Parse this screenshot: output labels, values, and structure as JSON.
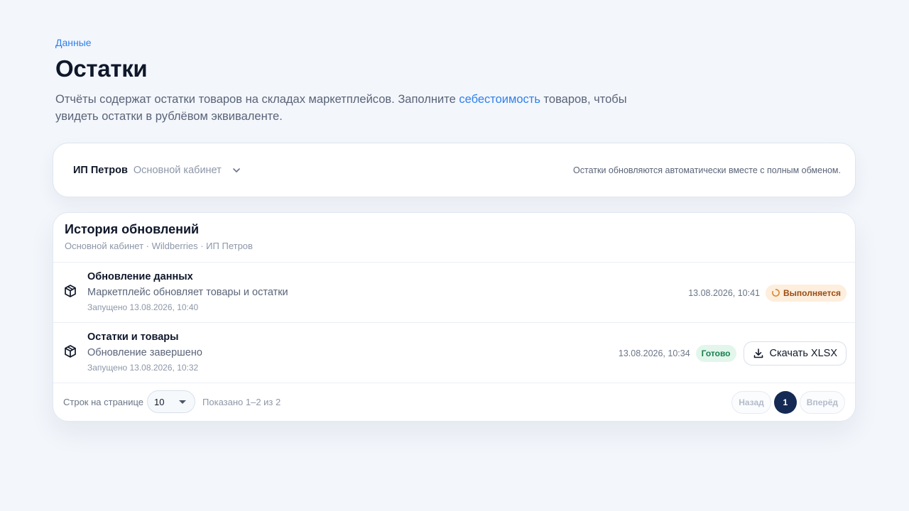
{
  "breadcrumb": "Данные",
  "page_title": "Остатки",
  "intro": {
    "before": "Отчёты содержат остатки товаров на складах маркетплейсов. Заполните ",
    "link": "себестоимость",
    "after": " товаров, чтобы увидеть остатки в рублёвом эквиваленте."
  },
  "account": {
    "name": "ИП Петров",
    "cabinet": "Основной кабинет",
    "note": "Остатки обновляются автоматически вместе с полным обменом."
  },
  "history": {
    "title": "История обновлений",
    "subtitle": "Основной кабинет · Wildberries · ИП Петров",
    "rows": [
      {
        "title": "Обновление данных",
        "desc": "Маркетплейс обновляет товары и остатки",
        "started": "Запущено 13.08.2026, 10:40",
        "time": "13.08.2026, 10:41",
        "status": "Выполняется"
      },
      {
        "title": "Остатки и товары",
        "desc": "Обновление завершено",
        "started": "Запущено 13.08.2026, 10:32",
        "time": "13.08.2026, 10:34",
        "status": "Готово",
        "action": "Скачать XLSX"
      }
    ]
  },
  "footer": {
    "rows_label": "Строк на странице",
    "rows_value": "10",
    "shown": "Показано 1–2 из 2",
    "prev": "Назад",
    "current_page": "1",
    "next": "Вперёд"
  },
  "colors": {
    "accent": "#2f80ed",
    "running_bg": "#fdeedd",
    "running_text": "#9a4b12",
    "done_bg": "#e3f6ec",
    "done_text": "#17804e",
    "page_active": "#142a54"
  },
  "icons": {
    "row": "box-icon",
    "running": "spinner-icon",
    "download": "download-icon",
    "account_dropdown": "chevron-down-icon",
    "rows_dropdown": "caret-down-icon"
  }
}
